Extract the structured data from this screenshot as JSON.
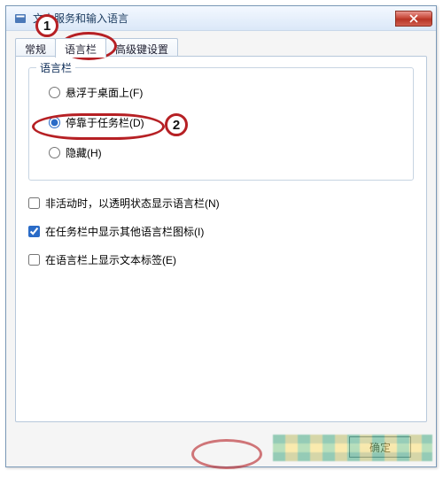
{
  "window": {
    "title": "文本服务和输入语言"
  },
  "tabs": {
    "general": "常规",
    "langbar": "语言栏",
    "advanced": "高级键设置"
  },
  "group": {
    "legend": "语言栏",
    "float": "悬浮于桌面上(F)",
    "docked": "停靠于任务栏(D)",
    "hidden": "隐藏(H)"
  },
  "checks": {
    "transparent": "非活动时，以透明状态显示语言栏(N)",
    "extra_icons": "在任务栏中显示其他语言栏图标(I)",
    "text_labels": "在语言栏上显示文本标签(E)"
  },
  "footer": {
    "ok": "确定"
  },
  "annotations": {
    "n1": "1",
    "n2": "2"
  }
}
